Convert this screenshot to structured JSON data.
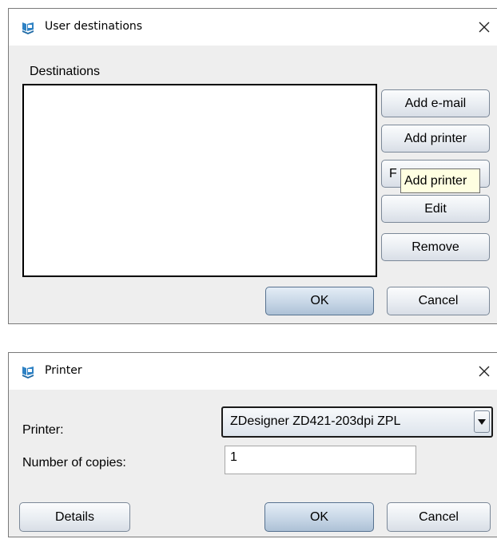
{
  "user_destinations_dialog": {
    "title": "User destinations",
    "destinations_label": "Destinations",
    "buttons": {
      "add_email": "Add e-mail",
      "add_printer": "Add printer",
      "clipped": "F",
      "edit": "Edit",
      "remove": "Remove",
      "ok": "OK",
      "cancel": "Cancel"
    },
    "tooltip": "Add printer"
  },
  "printer_dialog": {
    "title": "Printer",
    "printer_label": "Printer:",
    "printer_selected": "ZDesigner ZD421-203dpi ZPL",
    "copies_label": "Number of copies:",
    "copies_value": "1",
    "buttons": {
      "details": "Details",
      "ok": "OK",
      "cancel": "Cancel"
    }
  },
  "icons": {
    "app": "app-icon",
    "close": "close-icon",
    "dropdown": "chevron-down-icon"
  },
  "colors": {
    "app_icon": "#2f82c4",
    "dialog_bg": "#eeeeee",
    "tooltip_bg": "#ffffe1"
  }
}
